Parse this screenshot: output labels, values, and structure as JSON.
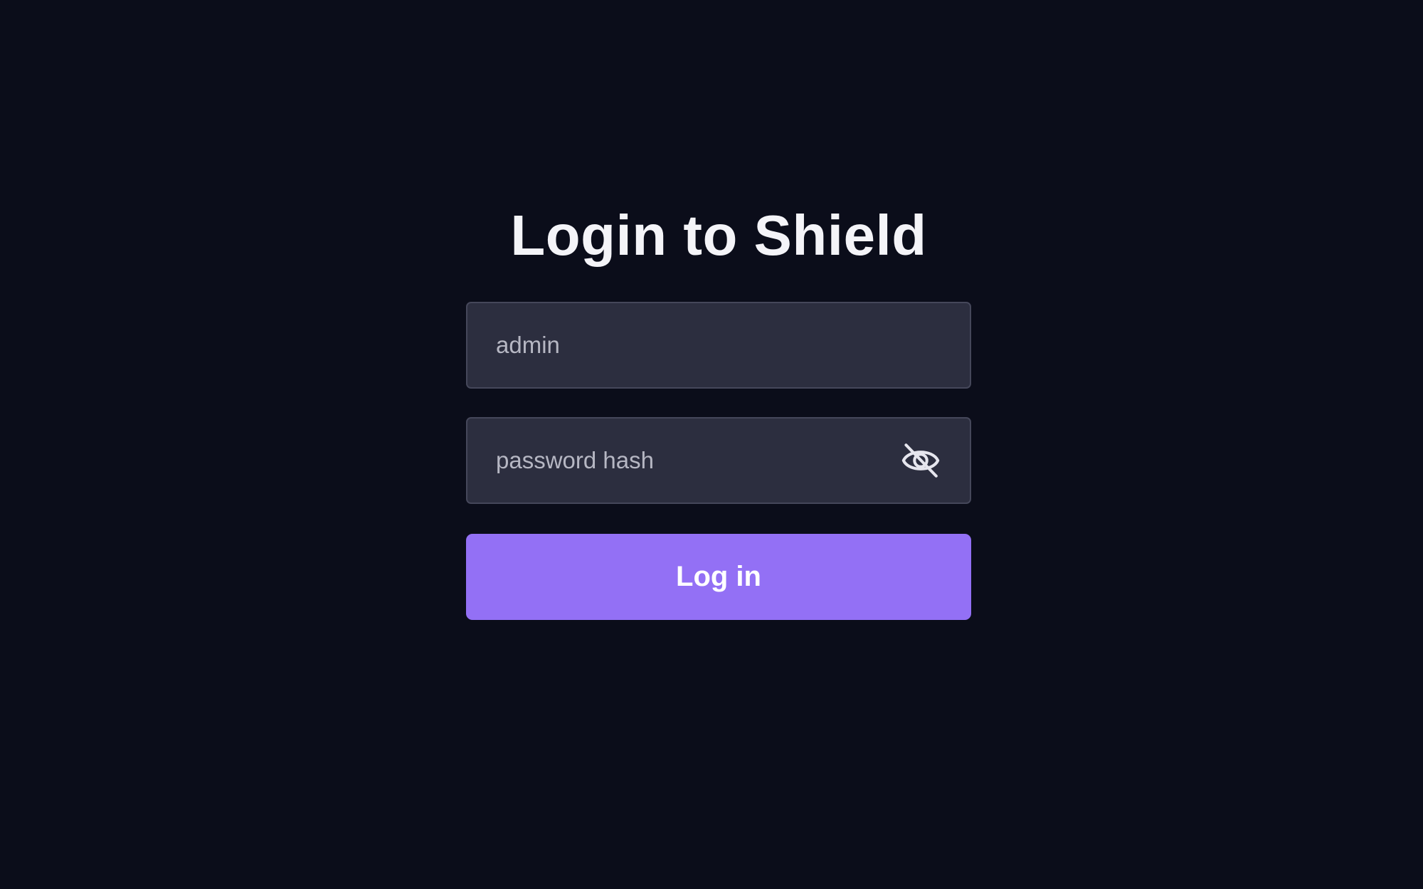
{
  "login": {
    "title": "Login to Shield",
    "username": {
      "value": "",
      "placeholder": "admin"
    },
    "password": {
      "value": "",
      "placeholder": "password hash",
      "toggle_icon": "eye-off-icon"
    },
    "submit_label": "Log in"
  },
  "colors": {
    "background": "#0b0d1a",
    "input_background": "#2c2e3f",
    "input_border": "#45475a",
    "accent": "#9370f5",
    "title_text": "#f4f4f8",
    "placeholder_text": "#b6b7c3"
  }
}
